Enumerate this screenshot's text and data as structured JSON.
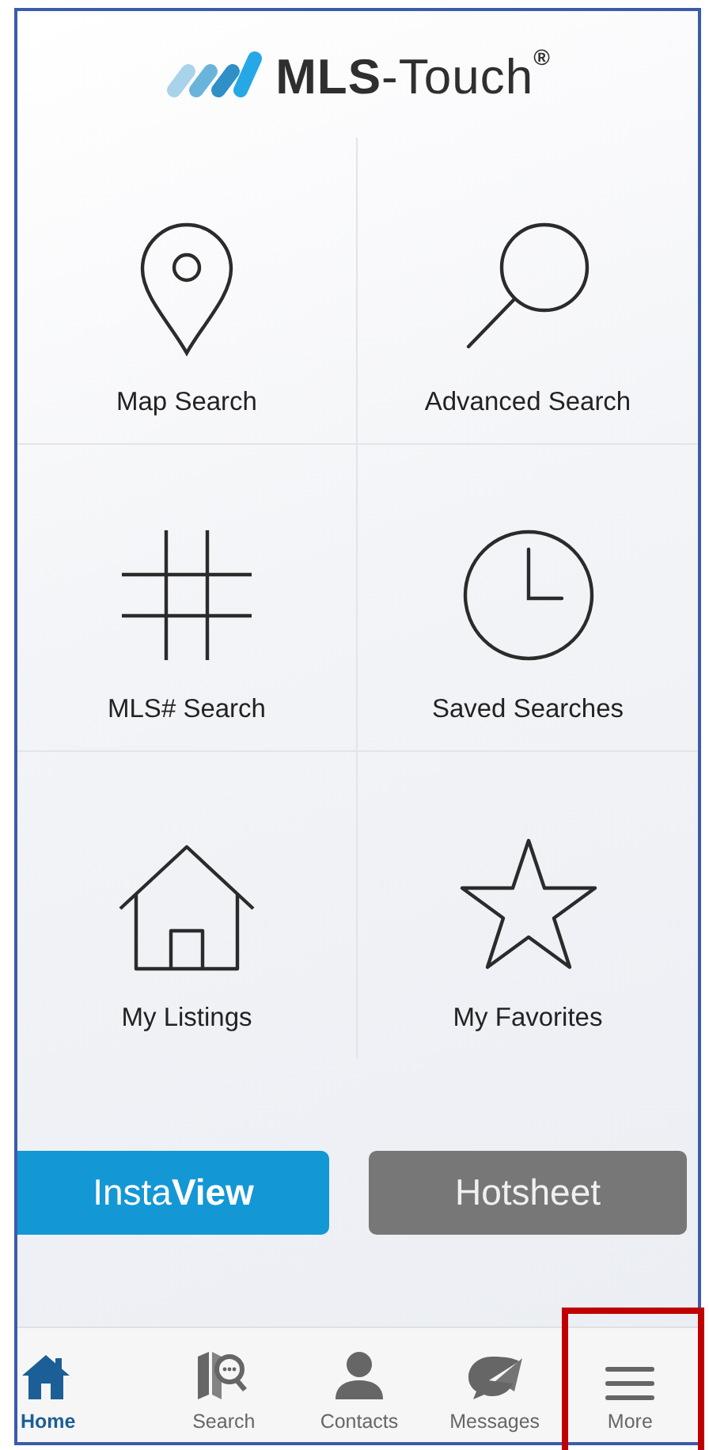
{
  "header": {
    "logo": "**MLS**-Touch$^{®}$"
  },
  "tiles": [
    {
      "kind": "pin",
      "label": "Map Search"
    },
    {
      "kind": "magnifier",
      "label": "Advanced Search"
    },
    {
      "kind": "hash",
      "label": "MLS# Search"
    },
    {
      "kind": "clock",
      "label": "Saved Searches"
    },
    {
      "kind": "house",
      "label": "My Listings"
    },
    {
      "kind": "star",
      "label": "My Favorites"
    }
  ],
  "buttons": [
    {
      "kind": "primary",
      "label": "Insta**View**"
    },
    {
      "kind": "secondary",
      "label": "Hotsheet"
    }
  ],
  "tab_bar": [
    {
      "kind": "home",
      "label": "Home",
      "selected": true,
      "highlighted": false
    },
    {
      "kind": "search",
      "label": "Search",
      "selected": false,
      "highlighted": false
    },
    {
      "kind": "contacts",
      "label": "Contacts",
      "selected": false,
      "highlighted": false
    },
    {
      "kind": "messages",
      "label": "Messages",
      "selected": false,
      "highlighted": false
    },
    {
      "kind": "more",
      "label": "More",
      "selected": false,
      "highlighted": true
    }
  ]
}
